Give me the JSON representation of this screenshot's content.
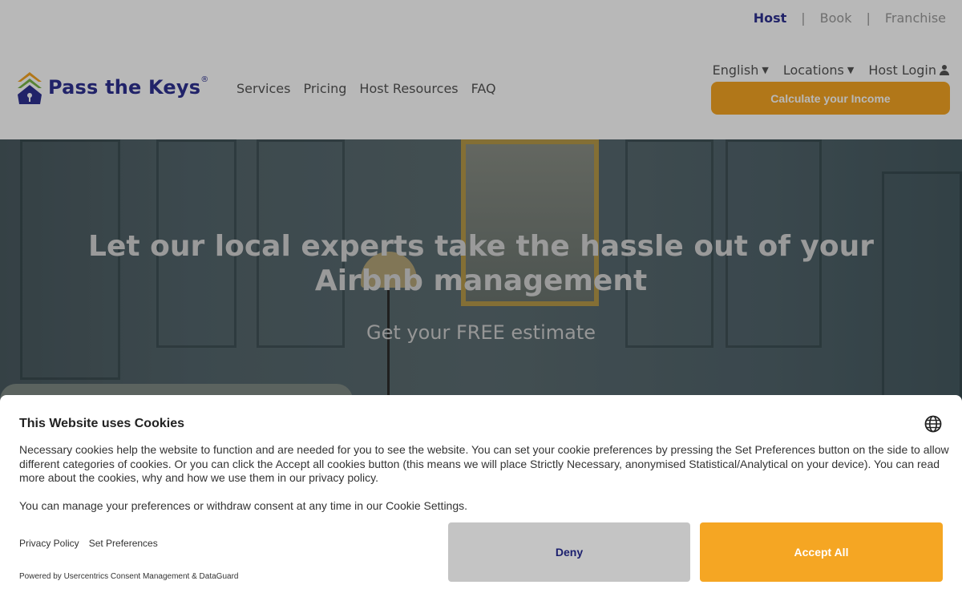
{
  "topbar": {
    "items": [
      {
        "label": "Host",
        "active": true
      },
      {
        "label": "Book",
        "active": false
      },
      {
        "label": "Franchise",
        "active": false
      }
    ],
    "separator": "|"
  },
  "header": {
    "logo": {
      "text": "Pass the Keys",
      "reg": "®"
    },
    "nav": [
      "Services",
      "Pricing",
      "Host Resources",
      "FAQ"
    ],
    "language": "English",
    "locations": "Locations",
    "login": "Host Login",
    "cta": "Calculate your Income"
  },
  "hero": {
    "title": "Let our local experts take the hassle out of your Airbnb management",
    "subtitle": "Get your FREE estimate"
  },
  "cookie": {
    "title": "This Website uses Cookies",
    "text": "Necessary cookies help the website to function and are needed for you to see the website. You can set your cookie preferences by pressing the Set Preferences button on the side to allow different categories of cookies. Or you can click the Accept all cookies button (this means we will place Strictly Necessary, anonymised Statistical/Analytical on your device). You can read more about the cookies, why and how we use them in our privacy policy.",
    "text2": "You can manage your preferences or withdraw consent at any time in our Cookie Settings.",
    "links": [
      "Privacy Policy",
      "Set Preferences"
    ],
    "powered": "Powered by Usercentrics Consent Management & DataGuard",
    "deny": "Deny",
    "accept": "Accept All"
  },
  "colors": {
    "brand": "#2e3192",
    "accent": "#f5a623",
    "deny_bg": "#c4c4c4"
  }
}
